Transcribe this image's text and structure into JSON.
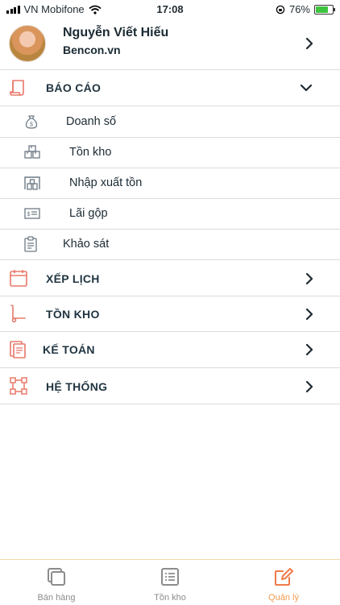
{
  "status_bar": {
    "carrier": "VN Mobifone",
    "time": "17:08",
    "battery": "76%",
    "battery_level": 0.76
  },
  "profile": {
    "name": "Nguyễn Viết Hiếu",
    "company": "Bencon.vn"
  },
  "menu": {
    "bao_cao": {
      "label": "BÁO CÁO",
      "expanded": true,
      "items": [
        {
          "label": "Doanh số",
          "icon": "money-bag-icon"
        },
        {
          "label": "Tồn kho",
          "icon": "boxes-icon"
        },
        {
          "label": "Nhập xuất tồn",
          "icon": "warehouse-icon"
        },
        {
          "label": "Lãi gộp",
          "icon": "bill-icon"
        },
        {
          "label": "Khảo sát",
          "icon": "clipboard-icon"
        }
      ]
    },
    "xep_lich": {
      "label": "XẾP LỊCH",
      "icon": "calendar-icon"
    },
    "ton_kho": {
      "label": "TỒN KHO",
      "icon": "hand-truck-icon"
    },
    "ke_toan": {
      "label": "KẾ TOÁN",
      "icon": "accounting-icon"
    },
    "he_thong": {
      "label": "HỆ THỐNG",
      "icon": "system-nodes-icon"
    }
  },
  "tabbar": {
    "tabs": [
      {
        "label": "Bán hàng",
        "icon": "stack-icon",
        "active": false
      },
      {
        "label": "Tồn kho",
        "icon": "list-icon",
        "active": false
      },
      {
        "label": "Quản lý",
        "icon": "edit-icon",
        "active": true
      }
    ]
  },
  "colors": {
    "accent": "#f29a4f",
    "icon_red": "#e8786a",
    "sub_icon": "#6d7a85",
    "text": "#1f3440"
  }
}
